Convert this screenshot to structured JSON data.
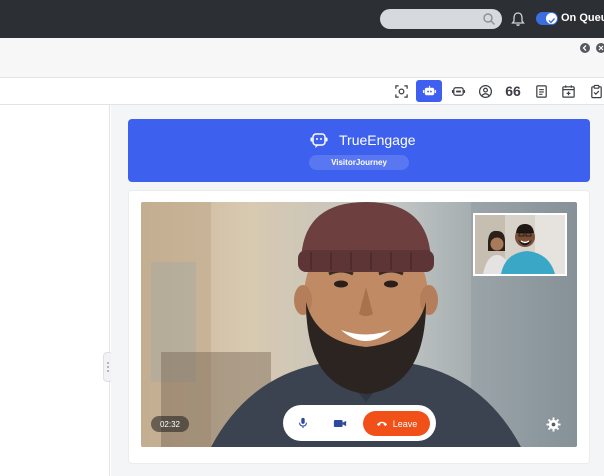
{
  "topbar": {
    "queue_label": "On Queue",
    "queue_on": true,
    "icons": [
      "search-icon",
      "bell-icon"
    ]
  },
  "toolbar": {
    "icons": [
      "scan-icon",
      "bot-icon",
      "agent-icon",
      "user-circle-icon",
      "quote-icon",
      "notes-icon",
      "calendar-icon",
      "clipboard-icon"
    ],
    "quote_glyph": "66",
    "active_index": 1
  },
  "widget": {
    "brand_name": "TrueEngage",
    "subtitle": "VisitorJourney",
    "brand_color": "#3e60ef"
  },
  "call": {
    "timer": "02:32",
    "leave_label": "Leave",
    "leave_color": "#f25019"
  }
}
